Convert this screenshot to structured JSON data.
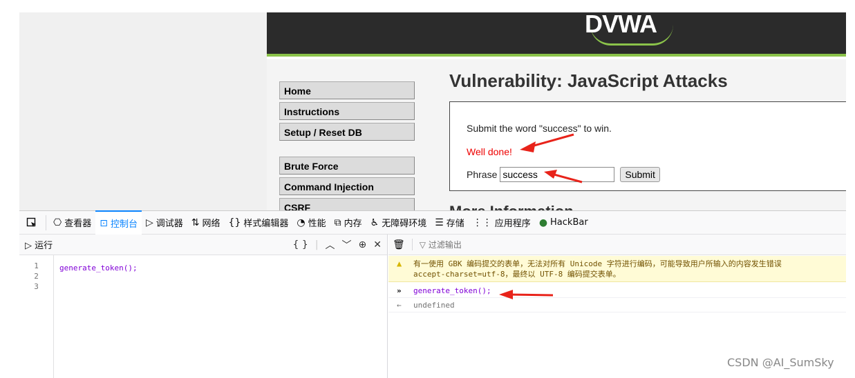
{
  "dvwa": {
    "logo": "DVWA",
    "menu_group1": [
      "Home",
      "Instructions",
      "Setup / Reset DB"
    ],
    "menu_group2": [
      "Brute Force",
      "Command Injection",
      "CSRF"
    ],
    "title": "Vulnerability: JavaScript Attacks",
    "instruction": "Submit the word \"success\" to win.",
    "result": "Well done!",
    "phrase_label": "Phrase",
    "phrase_value": "success",
    "submit_label": "Submit",
    "more_info": "More Information"
  },
  "devtools": {
    "tabs": [
      {
        "icon": "⎔",
        "label": "查看器"
      },
      {
        "icon": "⊡",
        "label": "控制台"
      },
      {
        "icon": "▷",
        "label": "调试器"
      },
      {
        "icon": "⇅",
        "label": "网络"
      },
      {
        "icon": "{}",
        "label": "样式编辑器"
      },
      {
        "icon": "◔",
        "label": "性能"
      },
      {
        "icon": "⧉",
        "label": "内存"
      },
      {
        "icon": "♿",
        "label": "无障碍环境"
      },
      {
        "icon": "☰",
        "label": "存储"
      },
      {
        "icon": "⋮⋮",
        "label": "应用程序"
      },
      {
        "icon": "●",
        "label": "HackBar"
      }
    ],
    "active_tab": "控制台",
    "editor": {
      "run_label": "▷ 运行",
      "lines": [
        "1",
        "2",
        "3"
      ],
      "code": "generate_token();"
    },
    "console": {
      "filter_placeholder": "过滤输出",
      "warning_line1": "有一使用 GBK 编码提交的表单，无法对所有 Unicode 字符进行编码，可能导致用户所输入的内容发生错误",
      "warning_line2": "accept-charset=utf-8，最终以 UTF-8 编码提交表单。",
      "command": "generate_token();",
      "result": "undefined"
    },
    "colors": {
      "accent": "#0a84ff",
      "warning_bg": "#fffbd6",
      "code": "#8000d7"
    }
  },
  "watermark": "CSDN @AI_SumSky"
}
